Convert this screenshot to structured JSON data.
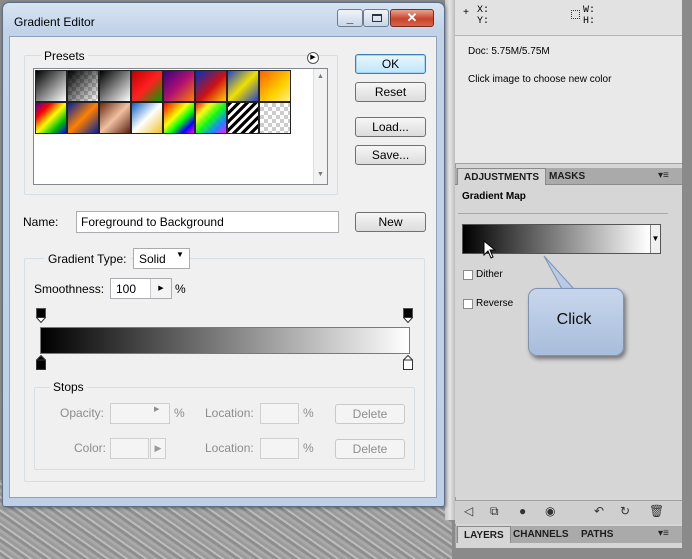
{
  "dialog": {
    "title": "Gradient Editor",
    "presets_label": "Presets",
    "buttons": {
      "ok": "OK",
      "reset": "Reset",
      "load": "Load...",
      "save": "Save...",
      "new": "New"
    },
    "name_label": "Name:",
    "name_value": "Foreground to Background",
    "gradient_type_label": "Gradient Type:",
    "gradient_type_value": "Solid",
    "smoothness_label": "Smoothness:",
    "smoothness_value": "100",
    "smoothness_unit": "%",
    "stops": {
      "label": "Stops",
      "opacity_label": "Opacity:",
      "color_label": "Color:",
      "location_label": "Location:",
      "percent": "%",
      "delete_label": "Delete"
    }
  },
  "photoshop": {
    "info": {
      "x": "X:",
      "y": "Y:",
      "w": "W:",
      "h": "H:",
      "doc": "Doc: 5.75M/5.75M",
      "hint": "Click image to choose new color"
    },
    "adjustments": {
      "tab_active": "ADJUSTMENTS",
      "tab_other": "MASKS",
      "title": "Gradient Map",
      "dither": "Dither",
      "reverse": "Reverse"
    },
    "layers_tabs": [
      "LAYERS",
      "CHANNELS",
      "PATHS"
    ]
  },
  "callout": {
    "text": "Click"
  },
  "colors": {
    "accent": "#3c7fb1",
    "title_bar": "#c2d3e8",
    "close_red": "#c9442c",
    "callout": "#b5c7e2"
  }
}
